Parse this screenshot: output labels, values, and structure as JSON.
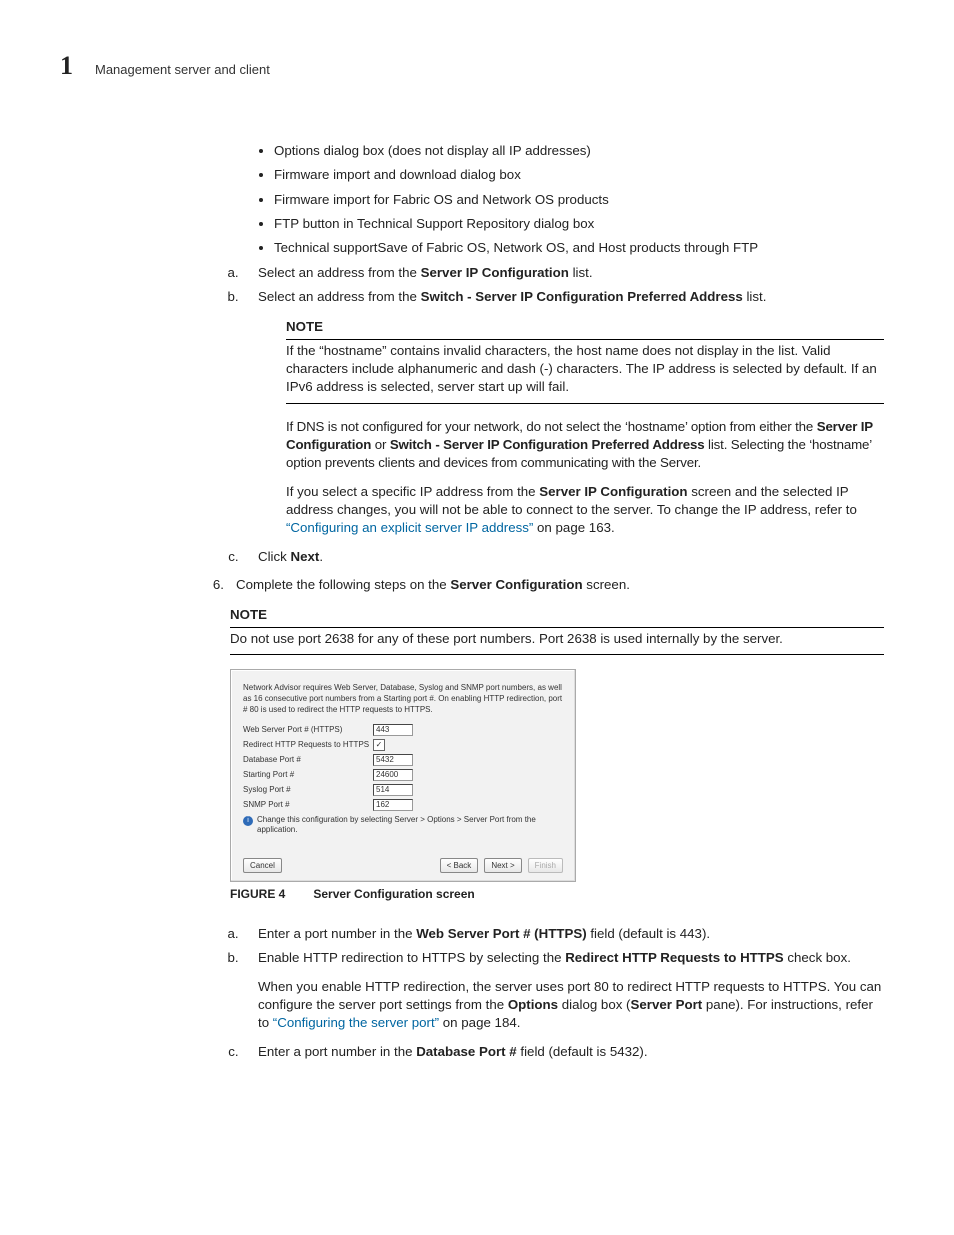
{
  "header": {
    "chapter_number": "1",
    "chapter_title": "Management server and client"
  },
  "bullets": [
    "Options dialog box (does not display all IP addresses)",
    "Firmware import and download dialog box",
    "Firmware import for Fabric OS and Network OS products",
    "FTP button in Technical Support Repository dialog box",
    "Technical supportSave of Fabric OS, Network OS, and Host products through FTP"
  ],
  "step_a": {
    "pre": "Select an address from the ",
    "bold": "Server IP Configuration",
    "post": " list."
  },
  "step_b": {
    "pre": "Select an address from the ",
    "bold": "Switch - Server IP Configuration Preferred Address",
    "post": " list."
  },
  "note1": {
    "label": "NOTE",
    "body": "If the “hostname” contains invalid characters, the host name does not display in the list. Valid characters include alphanumeric and dash (-) characters. The IP address is selected by default. If an IPv6 address is selected, server start up will fail."
  },
  "dns_para": {
    "pre": "If DNS is not configured for your network, do not select the ‘hostname’ option from either the ",
    "bold1": "Server IP Configuration",
    "mid": " or ",
    "bold2": "Switch - Server IP Configuration Preferred Address",
    "post": " list. Selecting the ‘hostname’ option prevents clients and devices from communicating with the Server."
  },
  "specific_ip_para": {
    "pre": "If you select a specific IP address from the ",
    "bold": "Server IP Configuration",
    "mid": " screen and the selected IP address changes, you will not be able to connect to the server. To change the IP address, refer to ",
    "link": "“Configuring an explicit server IP address”",
    "post": " on page 163."
  },
  "step_c": {
    "pre": "Click ",
    "bold": "Next",
    "post": "."
  },
  "step6": {
    "marker": "6.",
    "pre": "Complete the following steps on the ",
    "bold": "Server Configuration",
    "post": " screen."
  },
  "note2": {
    "label": "NOTE",
    "body": "Do not use port 2638 for any of these port numbers. Port 2638 is used internally by the server."
  },
  "mock": {
    "intro": "Network Advisor requires Web Server, Database, Syslog and SNMP port numbers, as well as 16 consecutive port numbers from a Starting port #. On enabling HTTP redirection, port # 80 is used to redirect the HTTP requests to HTTPS.",
    "rows": {
      "web_port_label": "Web Server Port # (HTTPS)",
      "web_port_value": "443",
      "redirect_label": "Redirect HTTP Requests to HTTPS",
      "redirect_checked": "✓",
      "db_port_label": "Database Port #",
      "db_port_value": "5432",
      "start_port_label": "Starting Port #",
      "start_port_value": "24600",
      "syslog_port_label": "Syslog Port #",
      "syslog_port_value": "514",
      "snmp_port_label": "SNMP Port #",
      "snmp_port_value": "162"
    },
    "info": "Change this configuration by selecting Server > Options > Server Port from the application.",
    "buttons": {
      "cancel": "Cancel",
      "back": "< Back",
      "next": "Next >",
      "finish": "Finish"
    }
  },
  "figure": {
    "label": "FIGURE 4",
    "title": "Server Configuration screen"
  },
  "lower_a": {
    "pre": "Enter a port number in the ",
    "bold": "Web Server Port # (HTTPS)",
    "post": " field (default is 443)."
  },
  "lower_b": {
    "pre": "Enable HTTP redirection to HTTPS by selecting the ",
    "bold": "Redirect HTTP Requests to HTTPS",
    "post": " check box."
  },
  "lower_b_para": {
    "p1": "When you enable HTTP redirection, the server uses port 80 to redirect HTTP requests to HTTPS. You can configure the server port settings from the ",
    "bold1": "Options",
    "p2": " dialog box (",
    "bold2": "Server Port",
    "p3": " pane). For instructions, refer to ",
    "link": "“Configuring the server port”",
    "p4": " on page 184."
  },
  "lower_c": {
    "pre": "Enter a port number in the ",
    "bold": "Database Port #",
    "post": " field (default is 5432)."
  }
}
